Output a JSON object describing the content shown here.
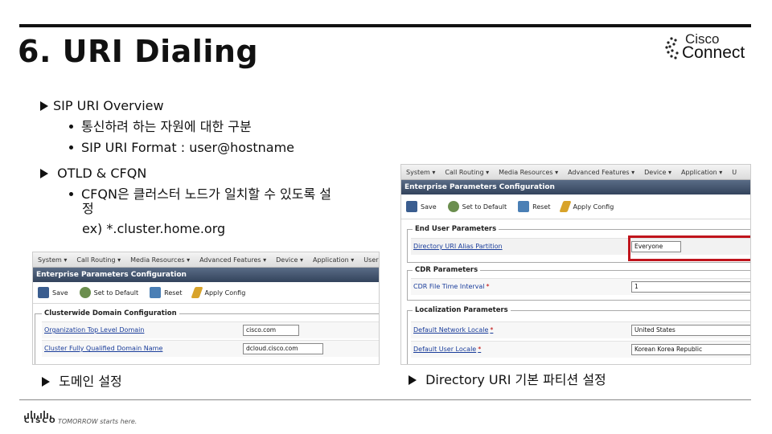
{
  "slide": {
    "title": "6. URI Dialing",
    "logo_line1": "Cisco",
    "logo_line2": "Connect"
  },
  "bullets": {
    "sip_overview": "SIP URI Overview",
    "sip_sub1": "통신하려 하는 자원에 대한 구분",
    "sip_sub2": "SIP URI Format : user@hostname",
    "otld": "OTLD & CFQN",
    "cfqn_line1": "CFQN은 클러스터 노드가 일치할 수 있도록 설",
    "cfqn_line2": "정",
    "cfqn_example": "ex) *.cluster.home.org"
  },
  "left_shot": {
    "menu": [
      "System ▾",
      "Call Routing ▾",
      "Media Resources ▾",
      "Advanced Features ▾",
      "Device ▾",
      "Application ▾",
      "User Mana"
    ],
    "header": "Enterprise Parameters Configuration",
    "toolbar": {
      "save": "Save",
      "set_default": "Set to Default",
      "reset": "Reset",
      "apply": "Apply Config"
    },
    "group_title": "Clusterwide Domain Configuration",
    "rows": [
      {
        "label": "Organization Top Level Domain",
        "value": "cisco.com"
      },
      {
        "label": "Cluster Fully Qualified Domain Name",
        "value": "dcloud.cisco.com"
      }
    ]
  },
  "right_shot": {
    "menu": [
      "System ▾",
      "Call Routing ▾",
      "Media Resources ▾",
      "Advanced Features ▾",
      "Device ▾",
      "Application ▾",
      "U"
    ],
    "header": "Enterprise Parameters Configuration",
    "toolbar": {
      "save": "Save",
      "set_default": "Set to Default",
      "reset": "Reset",
      "apply": "Apply Config"
    },
    "group1_title": "End User Parameters",
    "row1": {
      "label": "Directory URI Alias Partition",
      "value": "Everyone"
    },
    "group2_title": "CDR Parameters",
    "row2": {
      "label": "CDR File Time Interval",
      "required": "*",
      "value": "1"
    },
    "group3_title": "Localization Parameters",
    "row3": {
      "label": "Default Network Locale",
      "required": "*",
      "value": "United States"
    },
    "row4": {
      "label": "Default User Locale",
      "required": "*",
      "value": "Korean Korea Republic"
    }
  },
  "captions": {
    "left": "도메인 설정",
    "right": "Directory URI 기본 파티션 설정"
  },
  "footer": {
    "cisco": "CISCO",
    "tagline": "TOMORROW starts here."
  }
}
